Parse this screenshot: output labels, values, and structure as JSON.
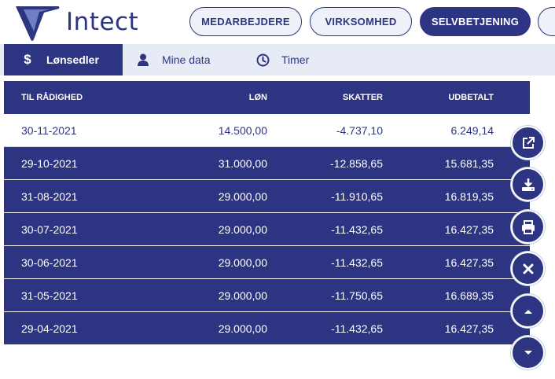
{
  "brand": {
    "name": "Intect"
  },
  "top_nav": [
    {
      "label": "MEDARBEJDERE"
    },
    {
      "label": "VIRKSOMHED"
    },
    {
      "label": "SELVBETJENING"
    }
  ],
  "sub_nav": [
    {
      "label": "Lønsedler",
      "icon": "dollar-icon"
    },
    {
      "label": "Mine data",
      "icon": "user-icon"
    },
    {
      "label": "Timer",
      "icon": "clock-icon"
    }
  ],
  "table": {
    "headers": [
      "TIL RÅDIGHED",
      "LØN",
      "SKATTER",
      "UDBETALT"
    ],
    "rows": [
      [
        "30-11-2021",
        "14.500,00",
        "-4.737,10",
        "6.249,14"
      ],
      [
        "29-10-2021",
        "31.000,00",
        "-12.858,65",
        "15.681,35"
      ],
      [
        "31-08-2021",
        "29.000,00",
        "-11.910,65",
        "16.819,35"
      ],
      [
        "30-07-2021",
        "29.000,00",
        "-11.432,65",
        "16.427,35"
      ],
      [
        "30-06-2021",
        "29.000,00",
        "-11.432,65",
        "16.427,35"
      ],
      [
        "31-05-2021",
        "29.000,00",
        "-11.750,65",
        "16.689,35"
      ],
      [
        "29-04-2021",
        "29.000,00",
        "-11.432,65",
        "16.427,35"
      ]
    ]
  },
  "actions": [
    "external-link-icon",
    "download-icon",
    "print-icon",
    "close-icon",
    "arrow-up-icon",
    "arrow-down-icon"
  ],
  "colors": {
    "primary": "#2d3582",
    "subnav_bg": "#e7ebf5",
    "pill_bg": "#eef1f8"
  }
}
